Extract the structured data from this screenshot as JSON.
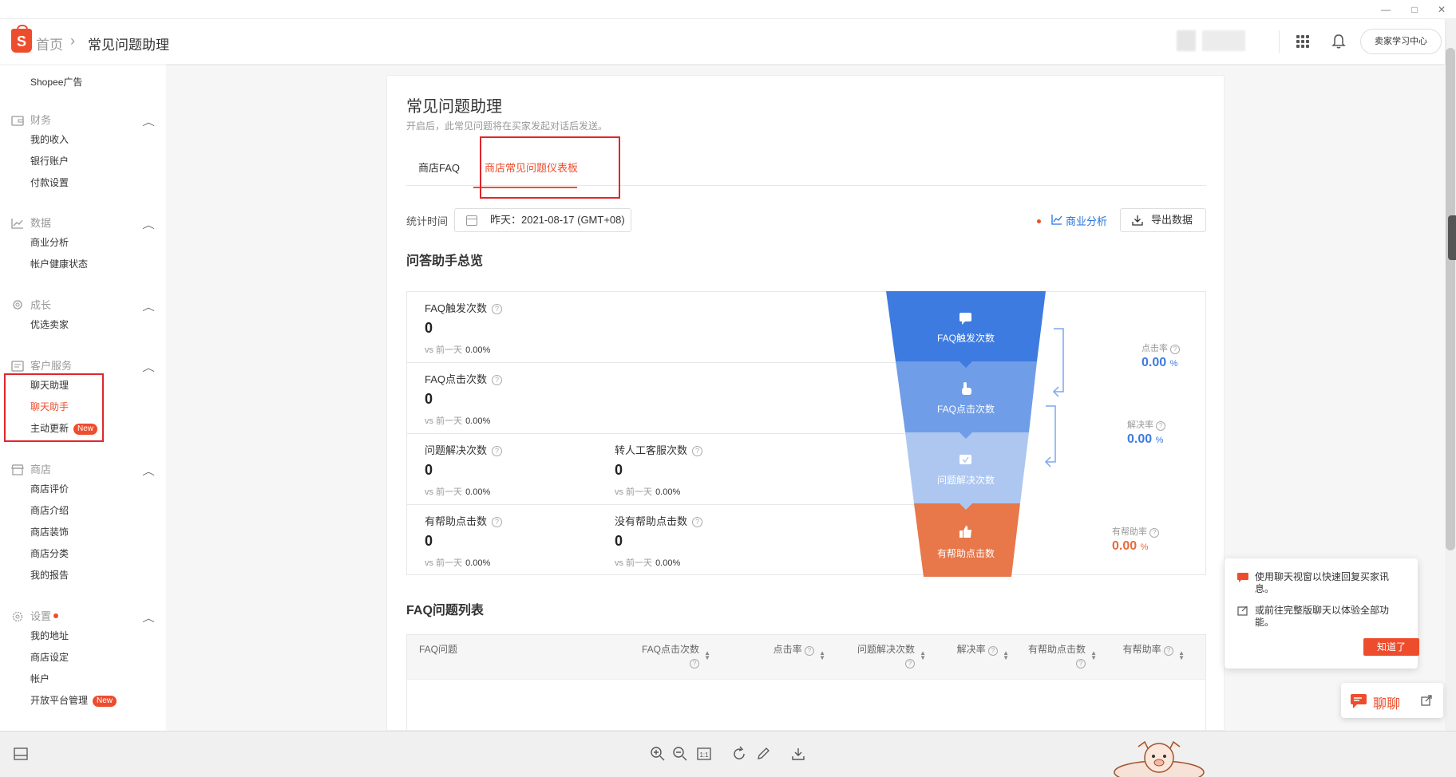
{
  "window": {
    "minimize": "—",
    "maximize": "□",
    "close": "✕"
  },
  "header": {
    "home": "首页",
    "separator": "›",
    "current": "常见问题助理",
    "learn_center": "卖家学习中心"
  },
  "sidebar": {
    "top_items": [
      {
        "label": "Shopee广告"
      }
    ],
    "groups": [
      {
        "title": "财务",
        "icon": "wallet-icon",
        "items": [
          {
            "label": "我的收入"
          },
          {
            "label": "银行账户"
          },
          {
            "label": "付款设置"
          }
        ]
      },
      {
        "title": "数据",
        "icon": "chart-icon",
        "items": [
          {
            "label": "商业分析"
          },
          {
            "label": "帐户健康状态"
          }
        ]
      },
      {
        "title": "成长",
        "icon": "badge-icon",
        "items": [
          {
            "label": "优选卖家"
          }
        ]
      },
      {
        "title": "客户服务",
        "icon": "service-icon",
        "items": [
          {
            "label": "聊天助理"
          },
          {
            "label": "聊天助手",
            "active": true
          },
          {
            "label": "主动更新",
            "badge": "New"
          }
        ]
      },
      {
        "title": "商店",
        "icon": "shop-icon",
        "items": [
          {
            "label": "商店评价"
          },
          {
            "label": "商店介绍"
          },
          {
            "label": "商店装饰"
          },
          {
            "label": "商店分类"
          },
          {
            "label": "我的报告"
          }
        ]
      },
      {
        "title": "设置",
        "icon": "gear-icon",
        "dot": true,
        "items": [
          {
            "label": "我的地址"
          },
          {
            "label": "商店设定"
          },
          {
            "label": "帐户"
          },
          {
            "label": "开放平台管理",
            "badge": "New"
          }
        ]
      }
    ]
  },
  "page": {
    "title": "常见问题助理",
    "subtitle": "开启后，此常见问题将在买家发起对话后发送。",
    "tabs": [
      {
        "label": "商店FAQ"
      },
      {
        "label": "商店常见问题仪表板",
        "active": true
      }
    ],
    "stat_time_label": "统计时间",
    "date_value": "昨天：2021-08-17 (GMT+08)",
    "business_analysis": "商业分析",
    "export": "导出数据"
  },
  "overview": {
    "title": "问答助手总览",
    "compare_label": "vs 前一天",
    "rows": [
      [
        {
          "label": "FAQ触发次数",
          "value": "0",
          "change": "0.00%"
        }
      ],
      [
        {
          "label": "FAQ点击次数",
          "value": "0",
          "change": "0.00%"
        }
      ],
      [
        {
          "label": "问题解决次数",
          "value": "0",
          "change": "0.00%"
        },
        {
          "label": "转人工客服次数",
          "value": "0",
          "change": "0.00%"
        }
      ],
      [
        {
          "label": "有帮助点击数",
          "value": "0",
          "change": "0.00%"
        },
        {
          "label": "没有帮助点击数",
          "value": "0",
          "change": "0.00%"
        }
      ]
    ],
    "funnel": [
      {
        "label": "FAQ触发次数",
        "icon": "chat-bubble-icon",
        "color": "#3d7be0"
      },
      {
        "label": "FAQ点击次数",
        "icon": "pointer-hand-icon",
        "color": "#6f9de8"
      },
      {
        "label": "问题解决次数",
        "icon": "check-bubble-icon",
        "color": "#adc7f1"
      },
      {
        "label": "有帮助点击数",
        "icon": "thumbs-up-icon",
        "color": "#e8774a"
      }
    ],
    "rates": [
      {
        "label": "点击率",
        "value": "0.00",
        "unit": "%",
        "color": "blue"
      },
      {
        "label": "解决率",
        "value": "0.00",
        "unit": "%",
        "color": "blue"
      },
      {
        "label": "有帮助率",
        "value": "0.00",
        "unit": "%",
        "color": "orange"
      }
    ]
  },
  "faq_list": {
    "title": "FAQ问题列表",
    "columns": [
      {
        "label": "FAQ问题"
      },
      {
        "label": "FAQ点击次数"
      },
      {
        "label": "点击率"
      },
      {
        "label": "问题解决次数"
      },
      {
        "label": "解决率"
      },
      {
        "label": "有帮助点击数"
      },
      {
        "label": "有帮助率"
      }
    ]
  },
  "chat_popup": {
    "line1": "使用聊天视窗以快速回复买家讯息。",
    "line2": "或前往完整版聊天以体验全部功能。",
    "button": "知道了"
  },
  "chat_button": {
    "label": "聊聊"
  },
  "colors": {
    "brand": "#ee4d2d",
    "link": "#2673dd",
    "highlight_box": "#e0262b"
  }
}
